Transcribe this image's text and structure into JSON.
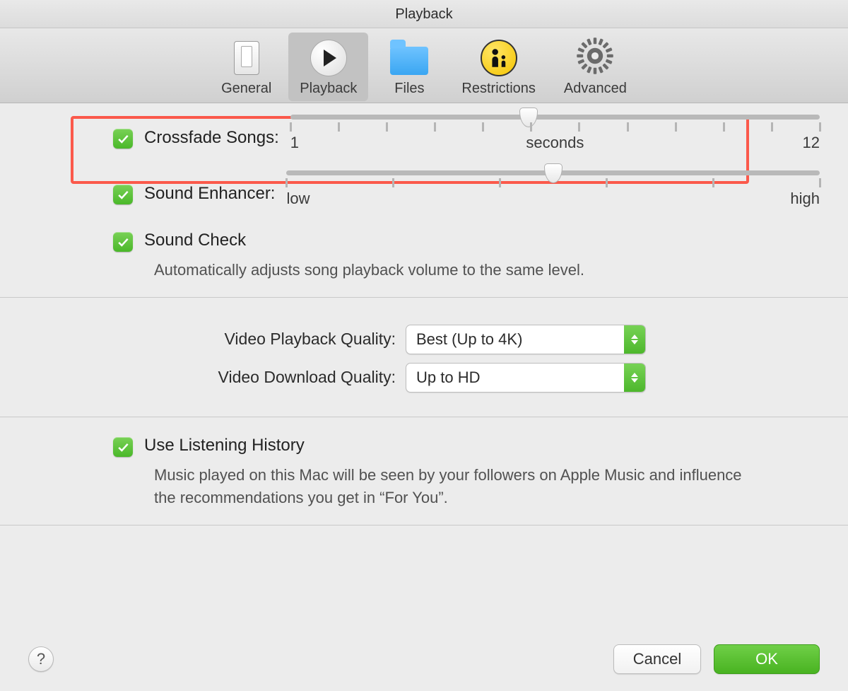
{
  "window": {
    "title": "Playback"
  },
  "tabs": {
    "general": "General",
    "playback": "Playback",
    "files": "Files",
    "restrictions": "Restrictions",
    "advanced": "Advanced",
    "selected": "playback"
  },
  "crossfade": {
    "checked": true,
    "label": "Crossfade Songs:",
    "min_label": "1",
    "center_label": "seconds",
    "max_label": "12",
    "min": 1,
    "max": 12,
    "value": 6,
    "thumb_percent": 45
  },
  "enhancer": {
    "checked": true,
    "label": "Sound Enhancer:",
    "left_label": "low",
    "right_label": "high",
    "thumb_percent": 50
  },
  "sound_check": {
    "checked": true,
    "label": "Sound Check",
    "hint": "Automatically adjusts song playback volume to the same level."
  },
  "video_playback": {
    "label": "Video Playback Quality:",
    "value": "Best (Up to 4K)"
  },
  "video_download": {
    "label": "Video Download Quality:",
    "value": "Up to HD"
  },
  "listening_history": {
    "checked": true,
    "label": "Use Listening History",
    "hint": "Music played on this Mac will be seen by your followers on Apple Music and influence the recommendations you get in “For You”."
  },
  "footer": {
    "help": "?",
    "cancel": "Cancel",
    "ok": "OK"
  },
  "colors": {
    "accent_green": "#4ab829",
    "highlight_red": "#fb594b"
  }
}
